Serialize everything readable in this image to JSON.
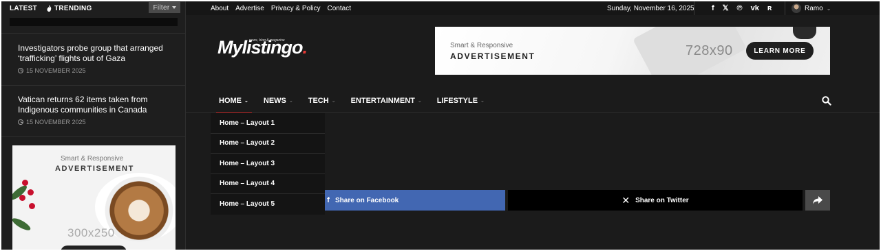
{
  "sidebar": {
    "tabs": [
      {
        "label": "LATEST"
      },
      {
        "label": "TRENDING"
      }
    ],
    "filter_label": "Filter",
    "items": [
      {
        "title": "Investigators probe group that arranged ‘trafficking’ flights out of Gaza",
        "date": "15 NOVEMBER 2025"
      },
      {
        "title": "Vatican returns 62 items taken from Indigenous communities in Canada",
        "date": "15 NOVEMBER 2025"
      }
    ],
    "ad": {
      "line1": "Smart & Responsive",
      "line2": "ADVERTISEMENT",
      "size": "300x250"
    }
  },
  "topbar": {
    "links": [
      "About",
      "Advertise",
      "Privacy & Policy",
      "Contact"
    ],
    "date": "Sunday, November 16, 2025",
    "social_icons": [
      "facebook-icon",
      "x-icon",
      "pinterest-icon",
      "vk-icon",
      "rss-icon"
    ],
    "user_name": "Ramo"
  },
  "header": {
    "logo_text": "Mylistingo",
    "logo_dot": ".",
    "tagline": "news, blog & magazine",
    "ad": {
      "line1": "Smart & Responsive",
      "line2": "ADVERTISEMENT",
      "size": "728x90",
      "button": "LEARN MORE"
    }
  },
  "nav": {
    "items": [
      {
        "label": "HOME"
      },
      {
        "label": "NEWS"
      },
      {
        "label": "TECH"
      },
      {
        "label": "ENTERTAINMENT"
      },
      {
        "label": "LIFESTYLE"
      }
    ],
    "dropdown": [
      "Home – Layout 1",
      "Home – Layout 2",
      "Home – Layout 3",
      "Home – Layout 4",
      "Home – Layout 5"
    ]
  },
  "share": {
    "facebook_label": "Share on Facebook",
    "twitter_label": "Share on Twitter"
  },
  "colors": {
    "accent": "#c62828",
    "facebook": "#4267b2",
    "background": "#1b1b1b"
  }
}
